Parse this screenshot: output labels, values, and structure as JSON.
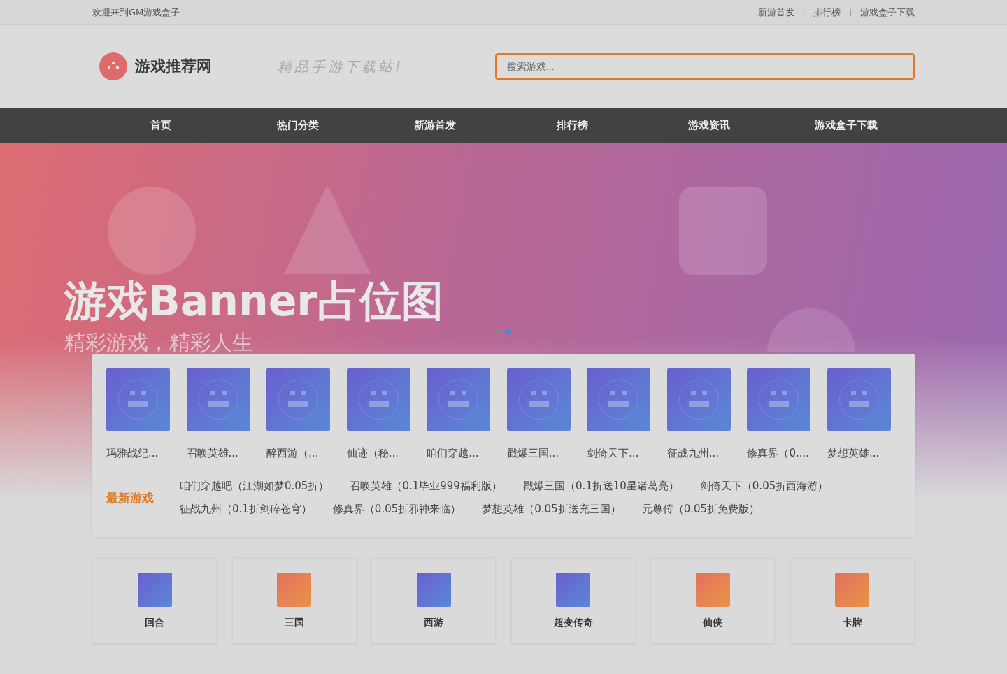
{
  "top_bar": {
    "welcome": "欢迎来到GM游戏盒子",
    "links": [
      "新游首发",
      "排行榜",
      "游戏盒子下载"
    ],
    "separator": "|"
  },
  "header": {
    "site_name": "游戏推荐网",
    "slogan": "精品手游下载站!",
    "search": {
      "placeholder": "搜索游戏..."
    }
  },
  "nav": [
    {
      "label": "首页"
    },
    {
      "label": "热门分类"
    },
    {
      "label": "新游首发"
    },
    {
      "label": "排行榜"
    },
    {
      "label": "游戏资讯"
    },
    {
      "label": "游戏盒子下载"
    }
  ],
  "banner": {
    "title": "游戏Banner占位图",
    "subtitle": "精彩游戏，精彩人生",
    "dots": [
      {
        "selected": false
      },
      {
        "selected": true
      }
    ]
  },
  "games": [
    {
      "name": "玛雅战纪..."
    },
    {
      "name": "召唤英雄..."
    },
    {
      "name": "醉西游（..."
    },
    {
      "name": "仙迹（秘..."
    },
    {
      "name": "咱们穿越..."
    },
    {
      "name": "戳爆三国..."
    },
    {
      "name": "剑倚天下..."
    },
    {
      "name": "征战九州..."
    },
    {
      "name": "修真界（0...."
    },
    {
      "name": "梦想英雄..."
    }
  ],
  "latest": {
    "label": "最新游戏",
    "links": [
      "咱们穿越吧（江湖如梦0.05折）",
      "召唤英雄（0.1毕业999福利版）",
      "戳爆三国（0.1折送10星诸葛亮）",
      "剑倚天下（0.05折西海游）",
      "征战九州（0.1折剑碎苍穹）",
      "修真界（0.05折邪神来临）",
      "梦想英雄（0.05折送充三国）",
      "元尊传（0.05折免费版）"
    ]
  },
  "categories": [
    {
      "label": "回合",
      "kind": "blue"
    },
    {
      "label": "三国",
      "kind": "orange"
    },
    {
      "label": "西游",
      "kind": "blue"
    },
    {
      "label": "超变传奇",
      "kind": "blue"
    },
    {
      "label": "仙侠",
      "kind": "orange"
    },
    {
      "label": "卡牌",
      "kind": "orange"
    }
  ]
}
